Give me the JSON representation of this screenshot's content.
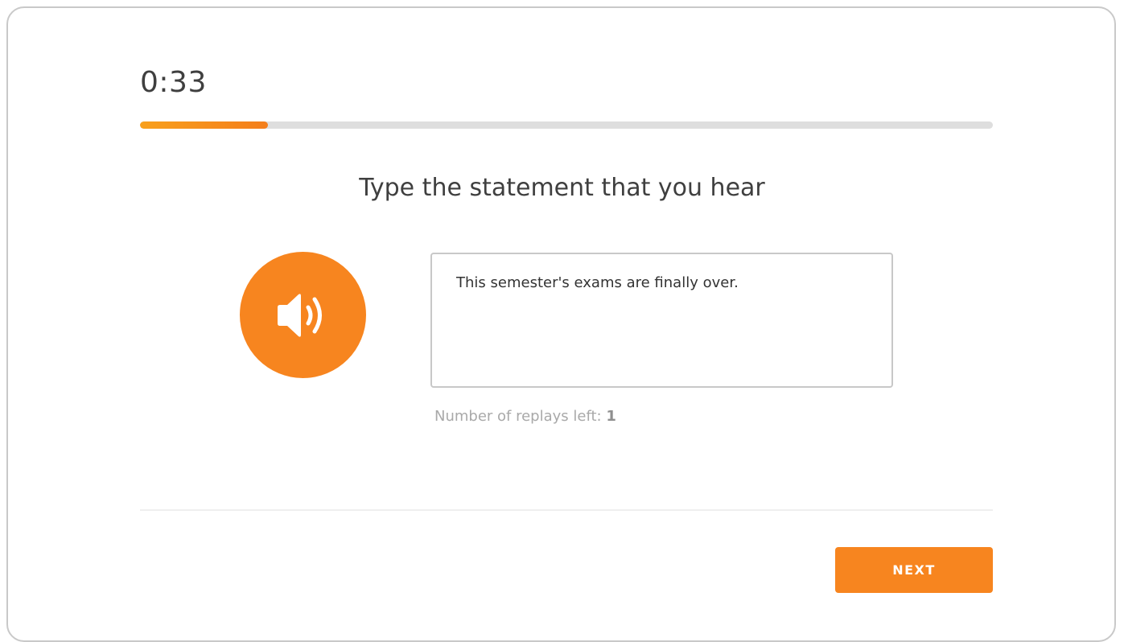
{
  "timer": {
    "value": "0:33"
  },
  "progress": {
    "fraction": 0.15
  },
  "prompt": {
    "title": "Type the statement that you hear"
  },
  "audio": {
    "icon": "speaker-icon"
  },
  "answer": {
    "value": "This semester's exams are finally over."
  },
  "replays": {
    "label": "Number of replays left: ",
    "count": "1"
  },
  "footer": {
    "next_label": "NEXT"
  },
  "colors": {
    "accent": "#f7851f",
    "progress_start": "#f8a01c",
    "track": "#dedede"
  }
}
